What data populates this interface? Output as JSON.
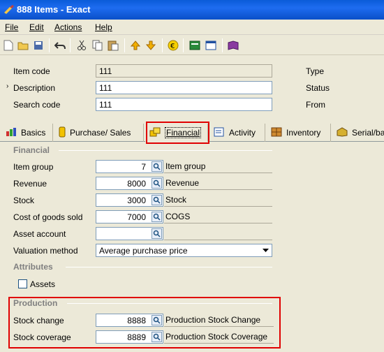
{
  "window": {
    "title": "888 Items - Exact"
  },
  "menu": {
    "items": [
      {
        "label": "File"
      },
      {
        "label": "Edit"
      },
      {
        "label": "Actions"
      },
      {
        "label": "Help"
      }
    ]
  },
  "header": {
    "item_code_label": "Item code",
    "item_code_value": "111",
    "description_label": "Description",
    "description_value": "111",
    "search_code_label": "Search code",
    "search_code_value": "111",
    "type_label": "Type",
    "status_label": "Status",
    "from_label": "From"
  },
  "tabs": [
    {
      "label": "Basics"
    },
    {
      "label": "Purchase/ Sales"
    },
    {
      "label": "Financial"
    },
    {
      "label": "Activity"
    },
    {
      "label": "Inventory"
    },
    {
      "label": "Serial/ba"
    }
  ],
  "financial": {
    "section_title": "Financial",
    "item_group_label": "Item group",
    "item_group_value": "7",
    "item_group_desc": "Item group",
    "revenue_label": "Revenue",
    "revenue_value": "8000",
    "revenue_desc": "Revenue",
    "stock_label": "Stock",
    "stock_value": "3000",
    "stock_desc": "Stock",
    "cogs_label": "Cost of goods sold",
    "cogs_value": "7000",
    "cogs_desc": "COGS",
    "asset_label": "Asset account",
    "asset_value": "",
    "valuation_label": "Valuation method",
    "valuation_value": "Average purchase price"
  },
  "attributes": {
    "section_title": "Attributes",
    "assets_label": "Assets"
  },
  "production": {
    "section_title": "Production",
    "stock_change_label": "Stock change",
    "stock_change_value": "8888",
    "stock_change_desc": "Production Stock Change",
    "stock_coverage_label": "Stock coverage",
    "stock_coverage_value": "8889",
    "stock_coverage_desc": "Production Stock Coverage"
  },
  "colors": {
    "title_bar": "#0a5bd8",
    "highlight": "#e00000"
  }
}
